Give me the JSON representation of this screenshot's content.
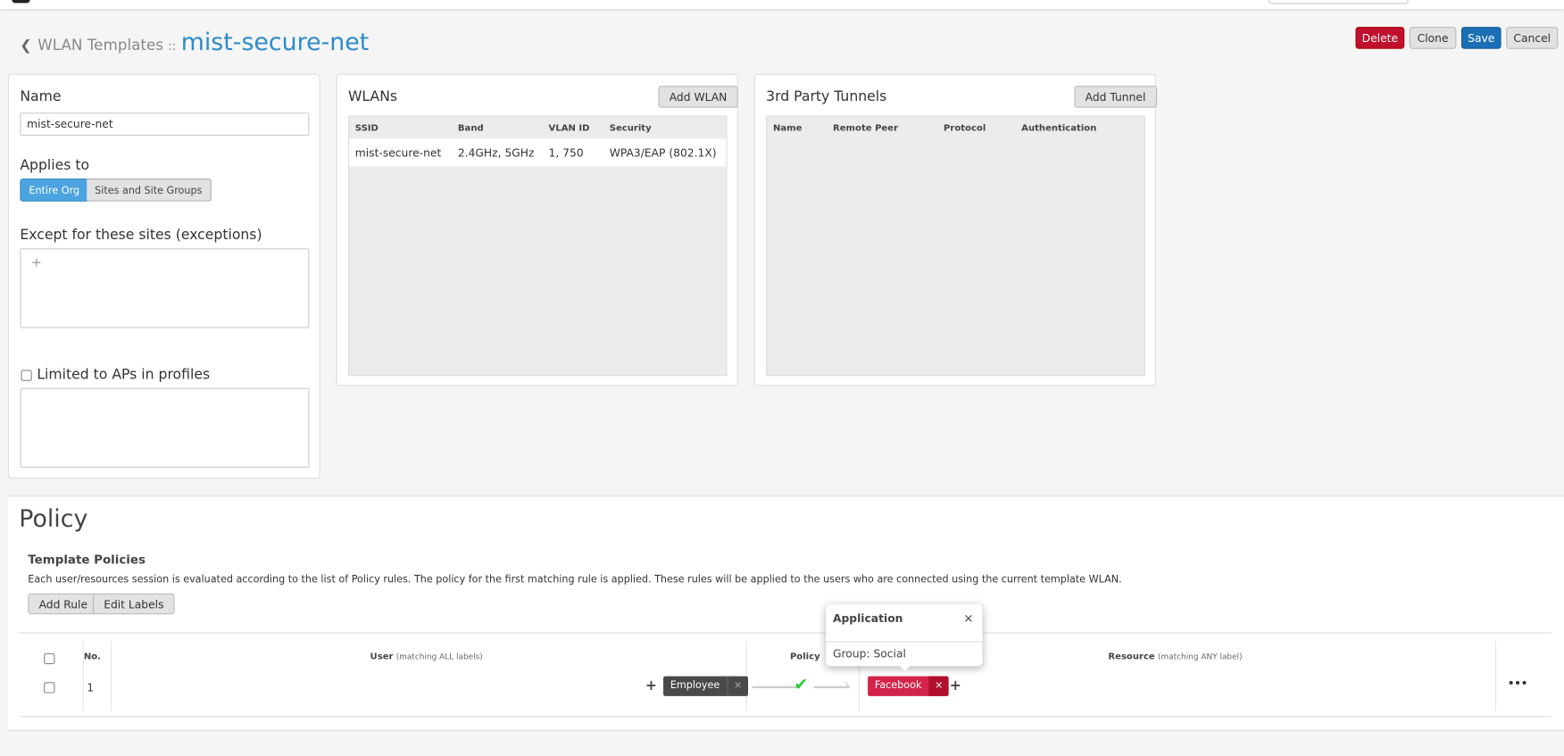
{
  "header": {
    "breadcrumb_parent": "WLAN Templates",
    "separator": "::",
    "title": "mist-secure-net"
  },
  "actions": {
    "delete": "Delete",
    "clone": "Clone",
    "save": "Save",
    "cancel": "Cancel"
  },
  "settings": {
    "name_label": "Name",
    "name_value": "mist-secure-net",
    "applies_label": "Applies to",
    "applies_options": [
      "Entire Org",
      "Sites and Site Groups"
    ],
    "applies_selected": "Entire Org",
    "exceptions_label": "Except for these sites (exceptions)",
    "add_symbol": "+",
    "limited_label": "Limited to APs in profiles",
    "limited_checked": false
  },
  "wlans": {
    "title": "WLANs",
    "add_label": "Add WLAN",
    "columns": [
      "SSID",
      "Band",
      "VLAN ID",
      "Security"
    ],
    "rows": [
      [
        "mist-secure-net",
        "2.4GHz, 5GHz",
        "1, 750",
        "WPA3/EAP (802.1X)"
      ]
    ]
  },
  "tunnels": {
    "title": "3rd Party Tunnels",
    "add_label": "Add Tunnel",
    "columns": [
      "Name",
      "Remote Peer",
      "Protocol",
      "Authentication"
    ],
    "rows": []
  },
  "policy": {
    "title": "Policy",
    "subtitle": "Template Policies",
    "description": "Each user/resources session is evaluated according to the list of Policy rules. The policy for the first matching rule is applied. These rules will be applied to the users who are connected using the current template WLAN.",
    "add_rule": "Add Rule",
    "edit_labels": "Edit Labels",
    "col_no": "No.",
    "col_user": "User",
    "col_user_hint": "(matching ALL labels)",
    "col_policy": "Policy",
    "col_resource": "Resource",
    "col_resource_hint": "(matching ANY label)",
    "rules": [
      {
        "no": "1",
        "user_labels": [
          "Employee"
        ],
        "action": "allow",
        "resources": [
          "Facebook"
        ]
      }
    ],
    "colors": {
      "allow": "#2ecc40",
      "resource_tag": "#d4234a",
      "user_tag": "#4a4a4a"
    }
  },
  "popover": {
    "title": "Application",
    "body": "Group: Social",
    "close": "×"
  },
  "icons": {
    "back": "chevron-left-icon",
    "plus": "plus-icon",
    "remove": "×",
    "more": "•••",
    "check": "✔"
  }
}
